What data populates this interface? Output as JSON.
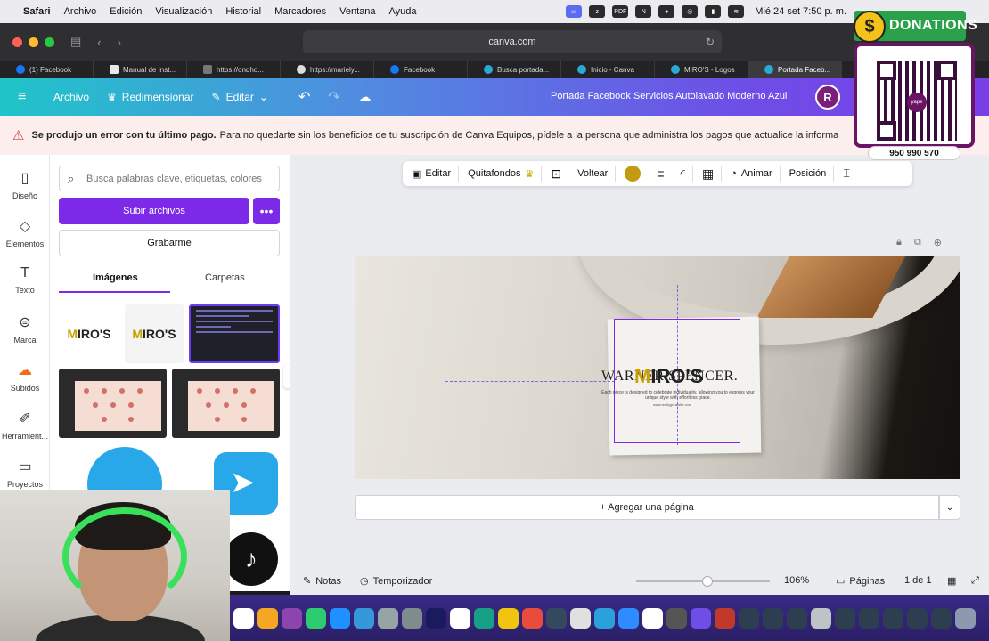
{
  "menubar": {
    "app": "Safari",
    "items": [
      "Archivo",
      "Edición",
      "Visualización",
      "Historial",
      "Marcadores",
      "Ventana",
      "Ayuda"
    ],
    "clock": "Mié 24 set 7:50 p. m."
  },
  "safari": {
    "url": "canva.com"
  },
  "tabs": [
    {
      "label": "(1) Facebook",
      "icon": "facebook-icon"
    },
    {
      "label": "Manual de Inst...",
      "icon": "document-icon"
    },
    {
      "label": "https://ondho...",
      "icon": "globe-icon"
    },
    {
      "label": "https://mariely...",
      "icon": "wordpress-icon"
    },
    {
      "label": "Facebook",
      "icon": "facebook-icon"
    },
    {
      "label": "Busca portada...",
      "icon": "canva-icon"
    },
    {
      "label": "Inicio - Canva",
      "icon": "canva-icon"
    },
    {
      "label": "MIRO'S - Logos",
      "icon": "canva-icon"
    },
    {
      "label": "Portada Faceb...",
      "icon": "canva-icon"
    }
  ],
  "canva_header": {
    "archivo": "Archivo",
    "redimensionar": "Redimensionar",
    "editar": "Editar",
    "doc_title": "Portada Facebook Servicios Autolavado Moderno Azul",
    "avatar_initial": "R"
  },
  "banner": {
    "bold": "Se produjo un error con tu último pago.",
    "text": "Para no quedarte sin los beneficios de tu suscripción de Canva Equipos, pídele a la persona que administra los pagos que actualice la informa"
  },
  "rail": [
    {
      "label": "Diseño",
      "icon": "layout-icon"
    },
    {
      "label": "Elementos",
      "icon": "shapes-icon"
    },
    {
      "label": "Texto",
      "icon": "text-icon"
    },
    {
      "label": "Marca",
      "icon": "brand-icon"
    },
    {
      "label": "Subidos",
      "icon": "cloud-upload-icon"
    },
    {
      "label": "Herramient...",
      "icon": "tools-icon"
    },
    {
      "label": "Proyectos",
      "icon": "folder-icon"
    }
  ],
  "panel": {
    "search_placeholder": "Busca palabras clave, etiquetas, colores",
    "upload_label": "Subir archivos",
    "more_label": "•••",
    "record_label": "Grabarme",
    "tab_images": "Imágenes",
    "tab_folders": "Carpetas",
    "logo_text_a": "M",
    "logo_text_b": "IRO'S"
  },
  "toolbar": {
    "editar": "Editar",
    "quitafondos": "Quitafondos",
    "voltear": "Voltear",
    "animar": "Animar",
    "posicion": "Posición",
    "color": "#c49a12"
  },
  "design": {
    "brand_overlay": "WARNER SPENCER.",
    "logo_a": "M",
    "logo_b": "IRO'S",
    "tagline": "Each piece is designed to celebrate individuality, allowing you to express your unique style with effortless grace.",
    "site": "www.reallygreatsite.com"
  },
  "add_page": "+ Agregar una página",
  "footer": {
    "notas": "Notas",
    "temporizador": "Temporizador",
    "zoom": "106%",
    "zoom_fraction": 0.53,
    "paginas": "Páginas",
    "page_count": "1 de 1"
  },
  "donations": {
    "title": "DONATIONS",
    "coin": "$",
    "qr_logo": "yape",
    "phone": "950 990 570"
  },
  "colors": {
    "canva_purple": "#7d2ae8",
    "banner_bg": "#fdeeee",
    "warning": "#d43c3c"
  }
}
